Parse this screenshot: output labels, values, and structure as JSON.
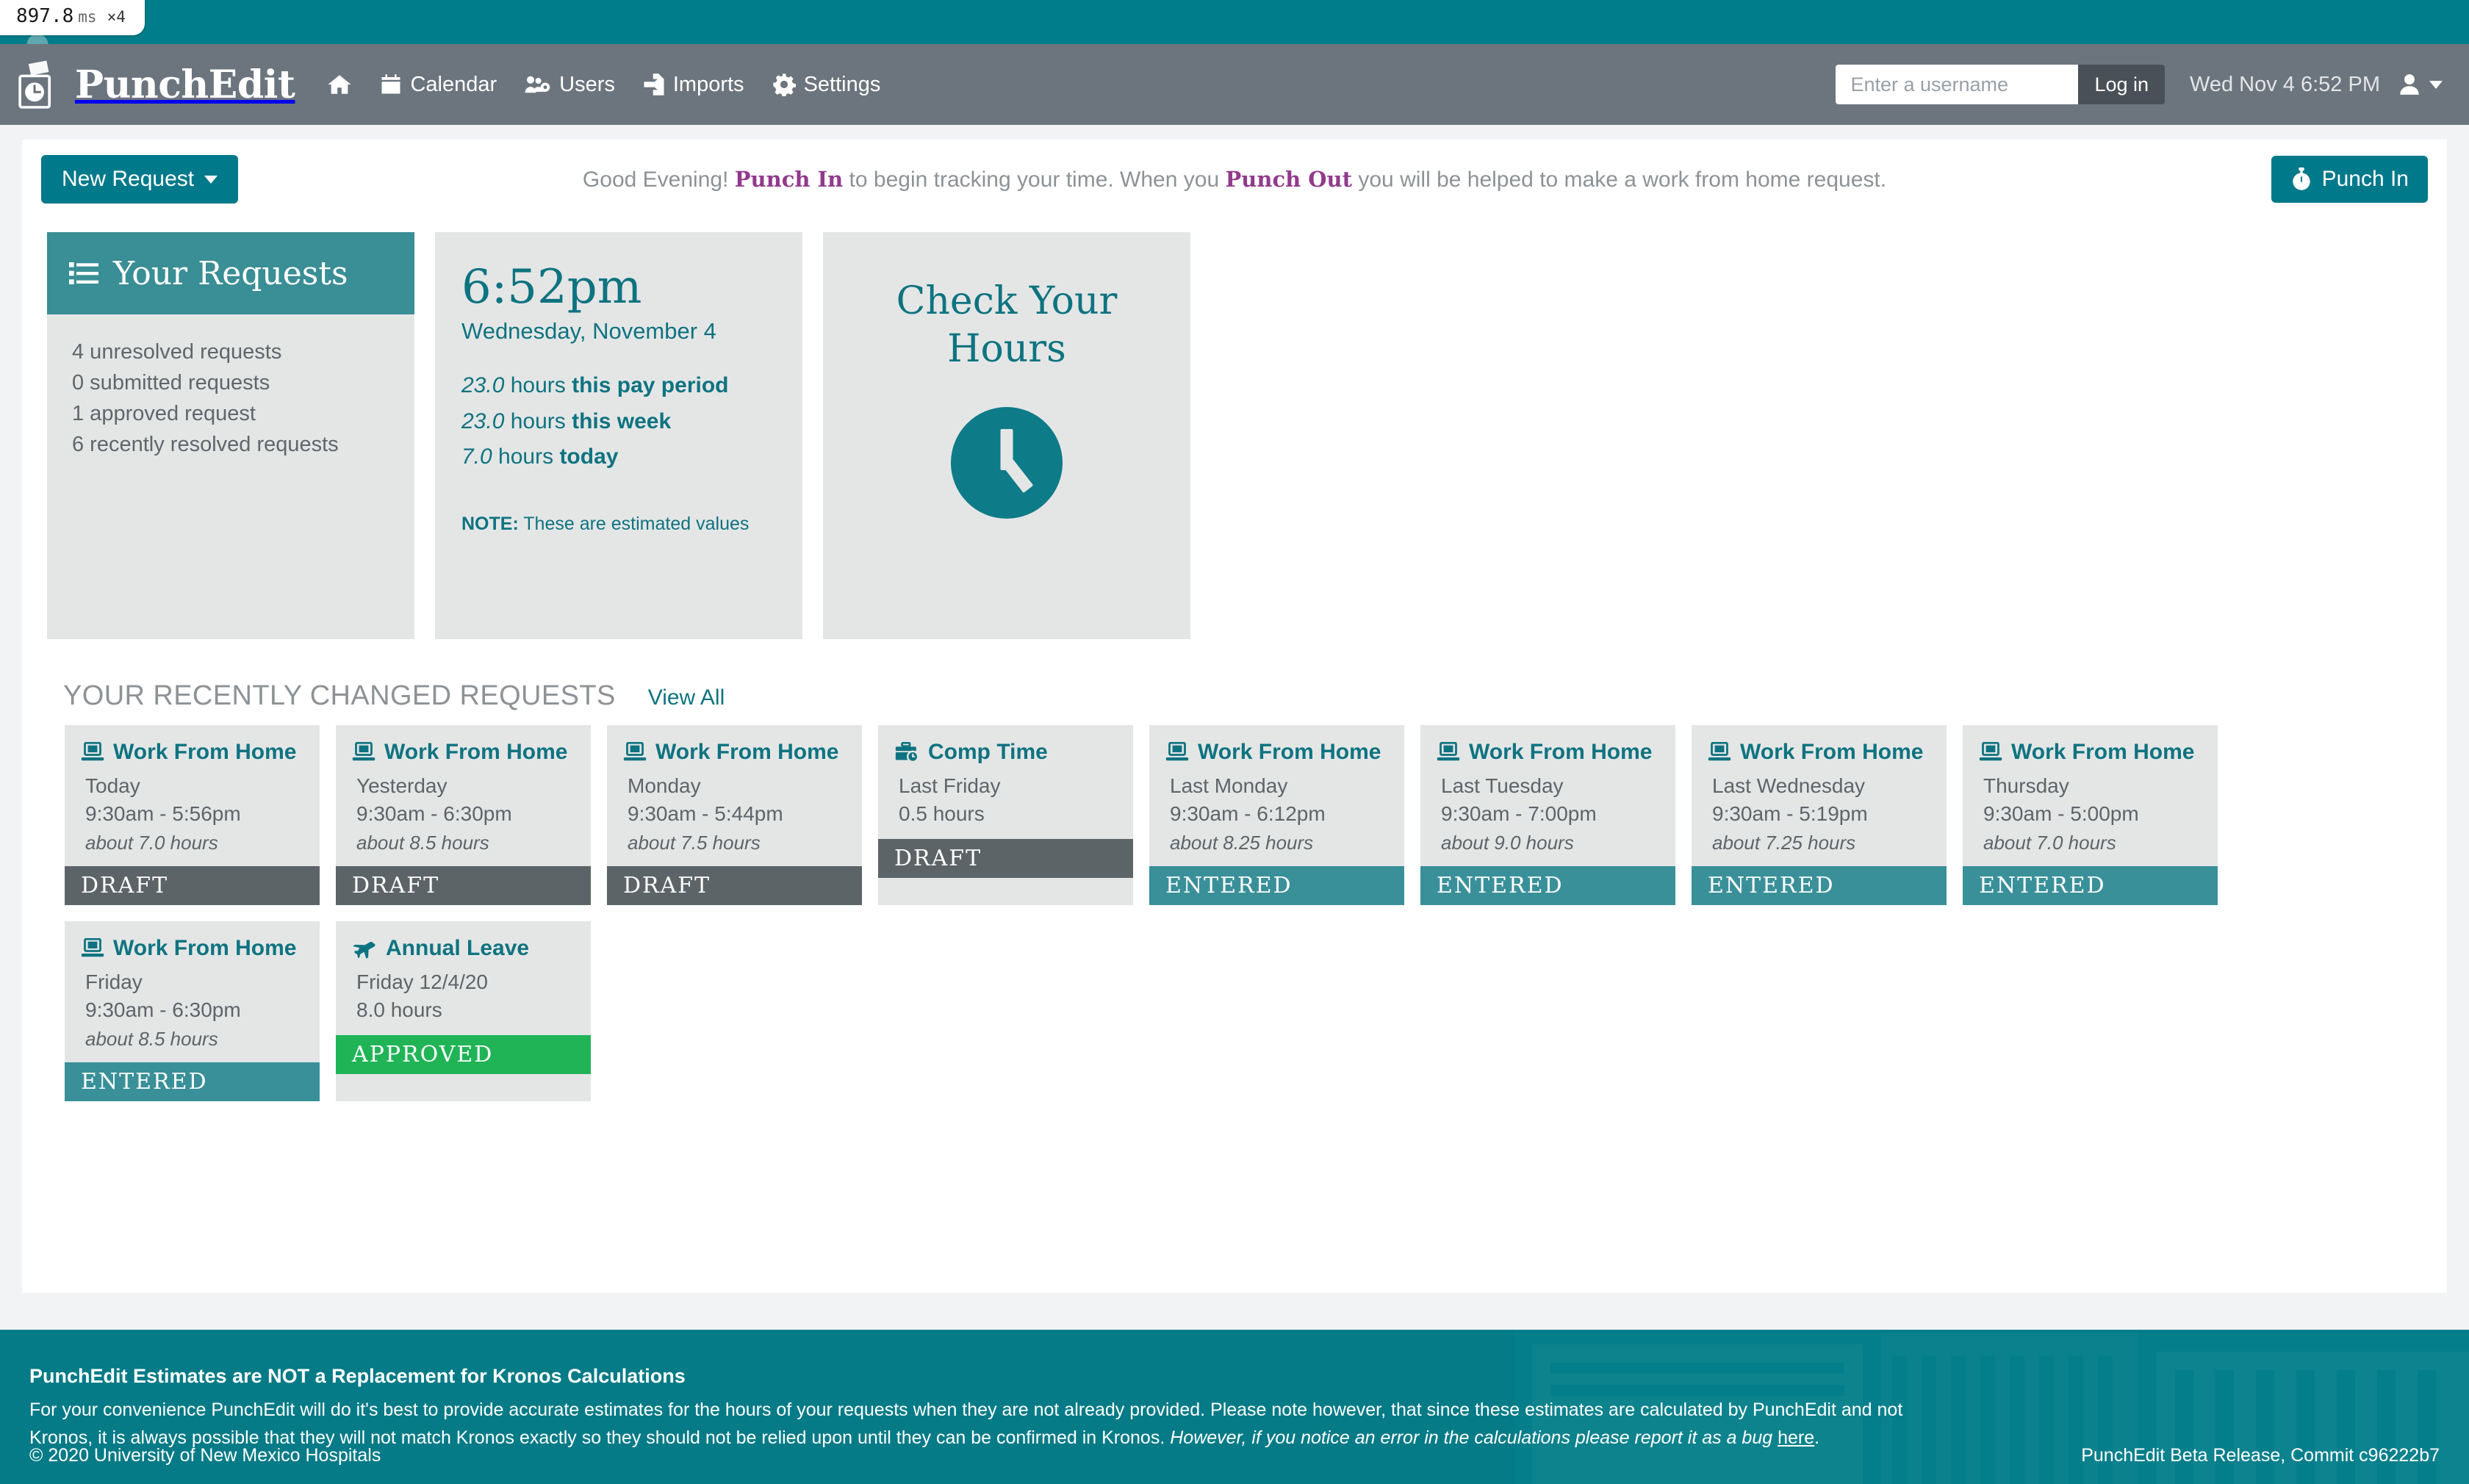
{
  "perf": {
    "value": "897.8",
    "unit": "ms",
    "multiplier": "×4"
  },
  "navbar": {
    "brand": "PunchEdit",
    "links": [
      {
        "label": "",
        "icon": "home-icon",
        "name": "home"
      },
      {
        "label": "Calendar",
        "icon": "calendar-icon",
        "name": "calendar"
      },
      {
        "label": "Users",
        "icon": "users-icon",
        "name": "users"
      },
      {
        "label": "Imports",
        "icon": "imports-icon",
        "name": "imports"
      },
      {
        "label": "Settings",
        "icon": "gear-icon",
        "name": "settings"
      }
    ],
    "login_placeholder": "Enter a username",
    "login_value": "",
    "login_button": "Log in",
    "clock": "Wed Nov 4 6:52 PM"
  },
  "toolbar": {
    "new_request_label": "New Request",
    "punch_in_label": "Punch In",
    "greeting_prefix": "Good Evening! ",
    "greeting_link1": "Punch In",
    "greeting_mid": " to begin tracking your time. When you ",
    "greeting_link2": "Punch Out",
    "greeting_suffix": " you will be helped to make a work from home request."
  },
  "requests_card": {
    "title": "Your Requests",
    "lines": [
      "4 unresolved requests",
      "0 submitted requests",
      "1 approved request",
      "6 recently resolved requests"
    ]
  },
  "time_card": {
    "time": "6:52pm",
    "date": "Wednesday, November 4",
    "hours": [
      {
        "value": "23.0",
        "unit": " hours ",
        "label": "this pay period"
      },
      {
        "value": "23.0",
        "unit": " hours ",
        "label": "this week"
      },
      {
        "value": "7.0",
        "unit": " hours ",
        "label": "today"
      }
    ],
    "note_label": "NOTE:",
    "note_text": " These are estimated values"
  },
  "hours_card": {
    "title": "Check Your Hours",
    "icon": "clock-icon"
  },
  "recent": {
    "heading": "YOUR RECENTLY CHANGED REQUESTS",
    "view_all": "View All",
    "cards": [
      {
        "type": "Work From Home",
        "icon": "laptop-icon",
        "when": "Today",
        "times": "9:30am - 5:56pm",
        "estimate": "about 7.0 hours",
        "status": "DRAFT"
      },
      {
        "type": "Work From Home",
        "icon": "laptop-icon",
        "when": "Yesterday",
        "times": "9:30am - 6:30pm",
        "estimate": "about 8.5 hours",
        "status": "DRAFT"
      },
      {
        "type": "Work From Home",
        "icon": "laptop-icon",
        "when": "Monday",
        "times": "9:30am - 5:44pm",
        "estimate": "about 7.5 hours",
        "status": "DRAFT"
      },
      {
        "type": "Comp Time",
        "icon": "briefcase-clock-icon",
        "when": "Last Friday",
        "times": "0.5 hours",
        "estimate": "",
        "status": "DRAFT"
      },
      {
        "type": "Work From Home",
        "icon": "laptop-icon",
        "when": "Last Monday",
        "times": "9:30am - 6:12pm",
        "estimate": "about 8.25 hours",
        "status": "ENTERED"
      },
      {
        "type": "Work From Home",
        "icon": "laptop-icon",
        "when": "Last Tuesday",
        "times": "9:30am - 7:00pm",
        "estimate": "about 9.0 hours",
        "status": "ENTERED"
      },
      {
        "type": "Work From Home",
        "icon": "laptop-icon",
        "when": "Last Wednesday",
        "times": "9:30am - 5:19pm",
        "estimate": "about 7.25 hours",
        "status": "ENTERED"
      },
      {
        "type": "Work From Home",
        "icon": "laptop-icon",
        "when": "Thursday",
        "times": "9:30am - 5:00pm",
        "estimate": "about 7.0 hours",
        "status": "ENTERED"
      },
      {
        "type": "Work From Home",
        "icon": "laptop-icon",
        "when": "Friday",
        "times": "9:30am - 6:30pm",
        "estimate": "about 8.5 hours",
        "status": "ENTERED"
      },
      {
        "type": "Annual Leave",
        "icon": "plane-icon",
        "when": "Friday 12/4/20",
        "times": "8.0 hours",
        "estimate": "",
        "status": "APPROVED"
      }
    ]
  },
  "footer": {
    "title": "PunchEdit Estimates are NOT a Replacement for Kronos Calculations",
    "body_plain": "For your convenience PunchEdit will do it's best to provide accurate estimates for the hours of your requests when they are not already provided. Please note however, that since these estimates are calculated by PunchEdit and not Kronos, it is always possible that they will not match Kronos exactly so they should not be relied upon until they can be confirmed in Kronos. ",
    "body_italic": "However, if you notice an error in the calculations please report it as a bug ",
    "bug_link": "here",
    "body_end": ".",
    "copyright": "© 2020 University of New Mexico Hospitals",
    "release": "PunchEdit Beta Release, Commit c96222b7"
  },
  "colors": {
    "teal": "#007d8a",
    "teal_dark": "#00798a",
    "navbar_gray": "#6c757d",
    "card_gray": "#e4e6e6",
    "status_draft": "#5d6468",
    "status_entered": "#3a9099",
    "status_approved": "#20b457",
    "magenta": "#913a8c"
  }
}
